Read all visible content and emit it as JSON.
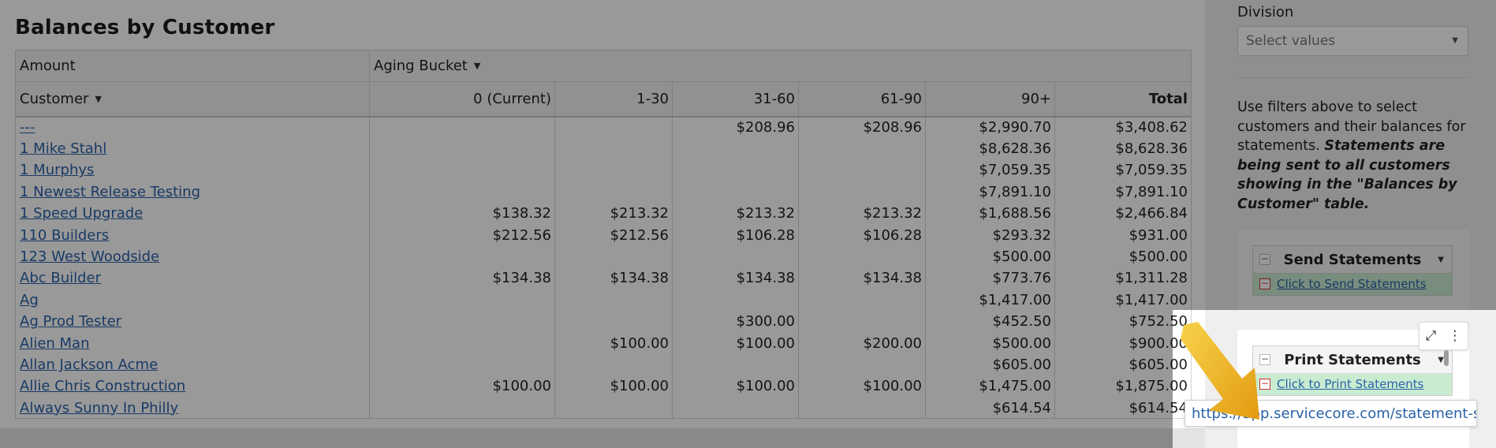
{
  "page_title": "Balances by Customer",
  "table": {
    "measure_label": "Amount",
    "column_group_label": "Aging Bucket",
    "row_field_label": "Customer",
    "columns": [
      "0 (Current)",
      "1-30",
      "31-60",
      "61-90",
      "90+",
      "Total"
    ],
    "rows": [
      {
        "customer": "---",
        "values": [
          "",
          "",
          "$208.96",
          "$208.96",
          "$2,990.70",
          "$3,408.62"
        ]
      },
      {
        "customer": "1 Mike Stahl",
        "values": [
          "",
          "",
          "",
          "",
          "$8,628.36",
          "$8,628.36"
        ]
      },
      {
        "customer": "1 Murphys",
        "values": [
          "",
          "",
          "",
          "",
          "$7,059.35",
          "$7,059.35"
        ]
      },
      {
        "customer": "1 Newest Release Testing",
        "values": [
          "",
          "",
          "",
          "",
          "$7,891.10",
          "$7,891.10"
        ]
      },
      {
        "customer": "1 Speed Upgrade",
        "values": [
          "$138.32",
          "$213.32",
          "$213.32",
          "$213.32",
          "$1,688.56",
          "$2,466.84"
        ]
      },
      {
        "customer": "110 Builders",
        "values": [
          "$212.56",
          "$212.56",
          "$106.28",
          "$106.28",
          "$293.32",
          "$931.00"
        ]
      },
      {
        "customer": "123 West Woodside",
        "values": [
          "",
          "",
          "",
          "",
          "$500.00",
          "$500.00"
        ]
      },
      {
        "customer": "Abc Builder",
        "values": [
          "$134.38",
          "$134.38",
          "$134.38",
          "$134.38",
          "$773.76",
          "$1,311.28"
        ]
      },
      {
        "customer": "Ag",
        "values": [
          "",
          "",
          "",
          "",
          "$1,417.00",
          "$1,417.00"
        ]
      },
      {
        "customer": "Ag Prod Tester",
        "values": [
          "",
          "",
          "$300.00",
          "",
          "$452.50",
          "$752.50"
        ]
      },
      {
        "customer": "Alien Man",
        "values": [
          "",
          "$100.00",
          "$100.00",
          "$200.00",
          "$500.00",
          "$900.00"
        ]
      },
      {
        "customer": "Allan Jackson Acme",
        "values": [
          "",
          "",
          "",
          "",
          "$605.00",
          "$605.00"
        ]
      },
      {
        "customer": "Allie Chris Construction ",
        "values": [
          "$100.00",
          "$100.00",
          "$100.00",
          "$100.00",
          "$1,475.00",
          "$1,875.00"
        ]
      },
      {
        "customer": "Always Sunny In Philly",
        "values": [
          "",
          "",
          "",
          "",
          "$614.54",
          "$614.54"
        ]
      }
    ]
  },
  "sidebar": {
    "division_label": "Division",
    "division_placeholder": "Select values",
    "help_text": "Use filters above to select customers and their balances for statements.",
    "help_emphasis": "Statements are being sent to all customers showing in the \"Balances by Customer\" table.",
    "send": {
      "title": "Send Statements",
      "link": "Click to Send Statements"
    },
    "print": {
      "title": "Print Statements",
      "link": "Click to Print Statements"
    },
    "url_tooltip": "https://app.servicecore.com/statement-s..."
  }
}
